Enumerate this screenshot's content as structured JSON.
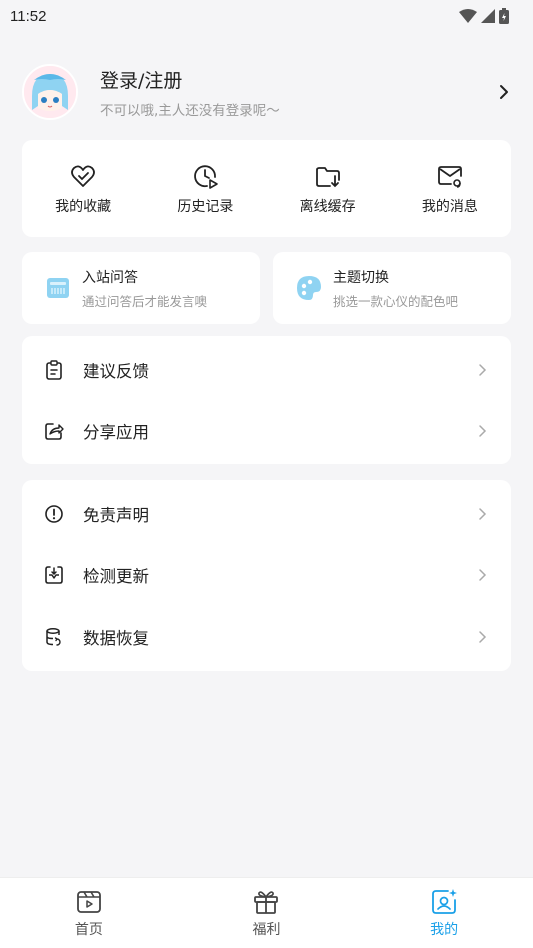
{
  "status": {
    "time": "11:52"
  },
  "profile": {
    "title": "登录/注册",
    "subtitle": "不可以哦,主人还没有登录呢～"
  },
  "quick_actions": [
    {
      "label": "我的收藏",
      "icon": "heart-check-icon"
    },
    {
      "label": "历史记录",
      "icon": "history-icon"
    },
    {
      "label": "离线缓存",
      "icon": "folder-download-icon"
    },
    {
      "label": "我的消息",
      "icon": "mail-icon"
    }
  ],
  "features": [
    {
      "title": "入站问答",
      "subtitle": "通过问答后才能发言噢",
      "icon": "quiz-icon"
    },
    {
      "title": "主题切换",
      "subtitle": "挑选一款心仪的配色吧",
      "icon": "palette-icon"
    }
  ],
  "menu_group_1": [
    {
      "label": "建议反馈",
      "icon": "clipboard-icon"
    },
    {
      "label": "分享应用",
      "icon": "share-icon"
    }
  ],
  "menu_group_2": [
    {
      "label": "免责声明",
      "icon": "info-icon"
    },
    {
      "label": "检测更新",
      "icon": "update-icon"
    },
    {
      "label": "数据恢复",
      "icon": "database-icon"
    }
  ],
  "tabs": [
    {
      "label": "首页",
      "icon": "home-video-icon",
      "active": false
    },
    {
      "label": "福利",
      "icon": "gift-icon",
      "active": false
    },
    {
      "label": "我的",
      "icon": "profile-icon",
      "active": true
    }
  ],
  "colors": {
    "accent": "#1aa0e8",
    "background": "#f5f5f7",
    "card": "#ffffff"
  }
}
